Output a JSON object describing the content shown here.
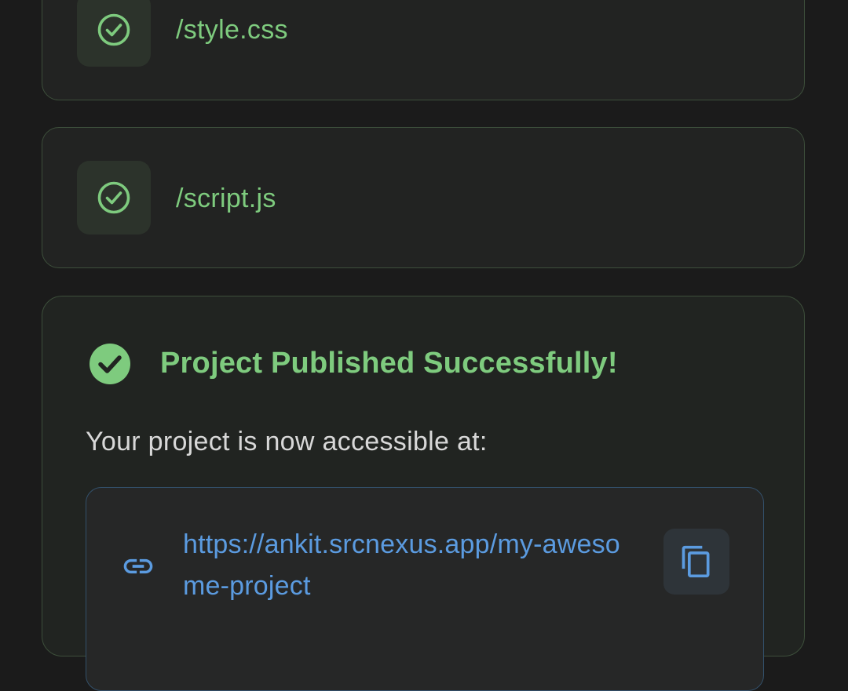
{
  "colors": {
    "background": "#1b1b1b",
    "success_green": "#7ecb7e",
    "link_blue": "#5b9be0",
    "card_border": "#3d4f3b",
    "text_muted": "#d8d8d8"
  },
  "files": [
    {
      "path": "/style.css",
      "status_icon": "check-circle-outline-icon"
    },
    {
      "path": "/script.js",
      "status_icon": "check-circle-outline-icon"
    }
  ],
  "publish": {
    "status_icon": "check-circle-filled-icon",
    "title": "Project Published Successfully!",
    "description": "Your project is now accessible at:",
    "url": "https://ankit.srcnexus.app/my-awesome-project",
    "link_icon": "link-icon",
    "copy_icon": "copy-icon"
  }
}
